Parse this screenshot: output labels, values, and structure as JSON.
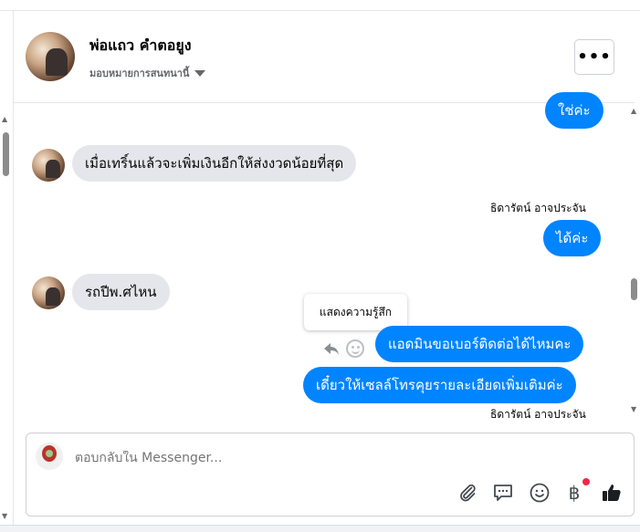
{
  "header": {
    "name": "พ่อแถว คำตอยูง",
    "subtitle": "มอบหมายการสนทนานี้",
    "more_label": "•••"
  },
  "messages": [
    {
      "direction": "out",
      "text": "ใช่ค่ะ"
    },
    {
      "direction": "in",
      "text": "เมื่อเทริ์นแล้วจะเพิ่มเงินอีกให้ส่งงวดน้อยที่สุด"
    },
    {
      "direction": "out",
      "sender": "ธิดารัตน์ อาจประจัน",
      "text": "ได้ค่ะ"
    },
    {
      "direction": "in",
      "text": "รถปีพ.ศไหน"
    },
    {
      "direction": "out",
      "text": "แอดมินขอเบอร์ติดต่อได้ไหมคะ"
    },
    {
      "direction": "out",
      "text": "เดี๋ยวให้เซลล์โทรคุยรายละเอียดเพิ่มเติมค่ะ"
    }
  ],
  "footer_sender": "ธิดารัตน์ อาจประจัน",
  "tooltip": "แสดงความรู้สึก",
  "composer": {
    "placeholder": "ตอบกลับใน Messenger..."
  },
  "icons": {
    "attach": "paperclip-icon",
    "saved_replies": "speech-bubble-icon",
    "emoji": "smiley-icon",
    "payment": "baht-icon",
    "like": "thumbs-up-icon",
    "more": "ellipsis-icon"
  },
  "colors": {
    "outgoing": "#0084ff",
    "incoming": "#e4e6eb",
    "notification_dot": "#f02849"
  }
}
